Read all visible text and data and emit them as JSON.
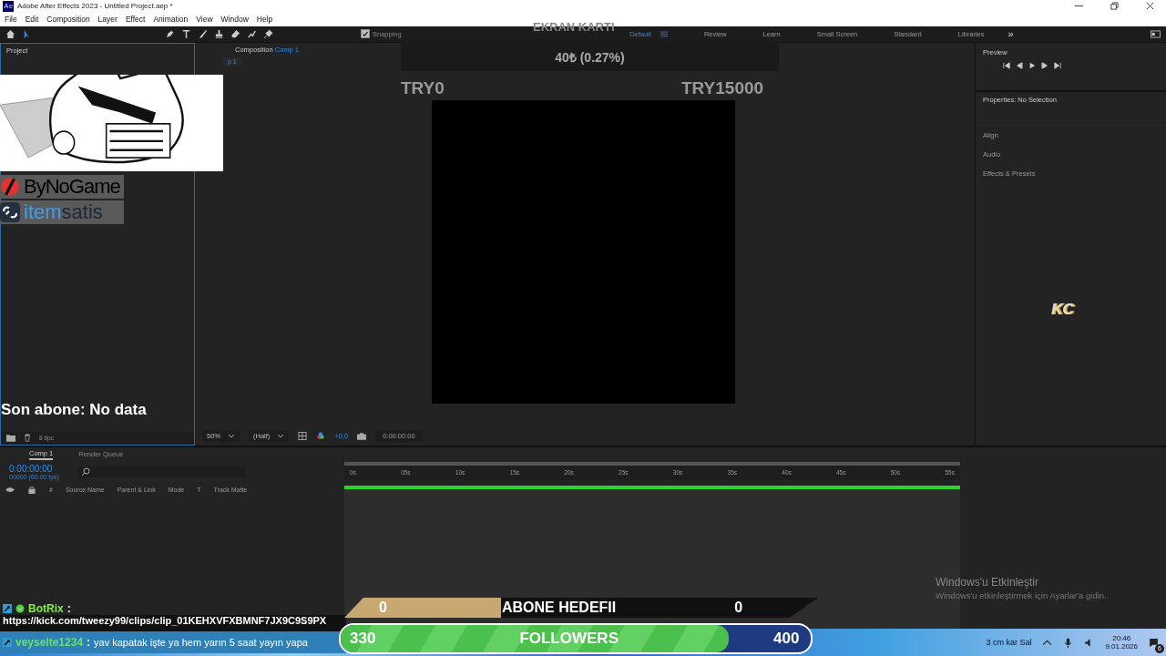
{
  "window": {
    "app_icon": "Ae",
    "title": "Adobe After Effects 2023 - Untitled Project.aep *"
  },
  "menu": [
    "File",
    "Edit",
    "Composition",
    "Layer",
    "Effect",
    "Animation",
    "View",
    "Window",
    "Help"
  ],
  "toolbar": {
    "snapping": {
      "label": "Snapping",
      "checked": true
    },
    "workspaces": [
      {
        "label": "Default",
        "selected": true
      },
      {
        "label": "Review",
        "selected": false
      },
      {
        "label": "Learn",
        "selected": false
      },
      {
        "label": "Small Screen",
        "selected": false
      },
      {
        "label": "Standard",
        "selected": false
      },
      {
        "label": "Libraries",
        "selected": false
      }
    ],
    "more": "»"
  },
  "project_panel": {
    "tab": "Project",
    "bit_depth": "8 bpc"
  },
  "composition_panel": {
    "tab": "Composition",
    "comp_name": "Comp 1",
    "sub_tab": "p 1",
    "zoom": "50%",
    "resolution": "(Half)",
    "exposure": "+0,0",
    "timecode": "0:00:00:00"
  },
  "right_panel": {
    "preview": "Preview",
    "properties": "Properties: No Selection",
    "sections": [
      "Align",
      "Audio",
      "Effects & Presets"
    ]
  },
  "timeline": {
    "tabs": [
      {
        "label": "Comp 1",
        "selected": true
      },
      {
        "label": "Render Queue",
        "selected": false
      }
    ],
    "time": "0:00:00:00",
    "frames": "00000 (60.00 fps)",
    "columns": [
      "#",
      "Source Name",
      "Parent & Link",
      "Mode",
      "T",
      "Track Matte"
    ],
    "ruler": [
      "0s",
      "05s",
      "10s",
      "15s",
      "20s",
      "25s",
      "30s",
      "35s",
      "40s",
      "45s",
      "50s",
      "55s"
    ]
  },
  "overlays": {
    "donation": {
      "title": "EKRAN KARTI",
      "amount": "40₺ (0.27%)",
      "min": "TRY0",
      "max": "TRY15000"
    },
    "sponsors": [
      {
        "kind": "bynogame",
        "text": "ByNoGame"
      },
      {
        "kind": "itemsatis",
        "text": "item",
        "text2": "satis"
      }
    ],
    "last_sub": "Son abone: No data",
    "kc_logo": "KC",
    "activation": {
      "title": "Windows'u Etkinleştir",
      "text": "Windows'u etkinleştirmek için Ayarlar'a gidin."
    },
    "chat": [
      {
        "user": "BotRix",
        "sep": ":",
        "message": "https://kick.com/tweezy99/clips/clip_01KEHXVFXBMNF7JX9C9S9PX",
        "color": "#7cf03c"
      },
      {
        "user": "veyselte1234",
        "sep": ":",
        "message": "yav kapatak işte ya hem yarın 5 saat yayın yapa",
        "color": "#6ae06a"
      }
    ],
    "sub_goal": {
      "current": "0",
      "label": "ABONE HEDEFII",
      "target": "0"
    },
    "followers": {
      "current": "330",
      "label": "FOLLOWERS",
      "target": "400",
      "level": 0.825
    }
  },
  "taskbar": {
    "weather": "3 cm kar Sal",
    "time": "20:46",
    "date": "9.01.2026",
    "badge": "6"
  }
}
